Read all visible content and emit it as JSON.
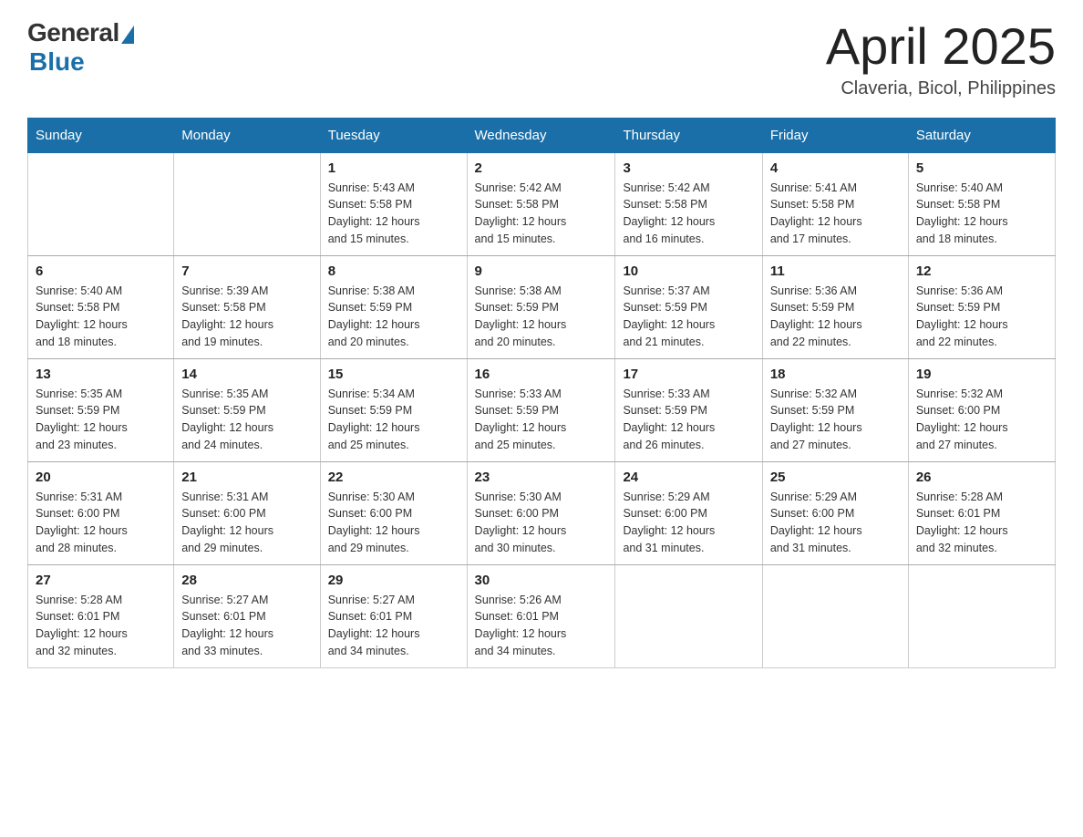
{
  "logo": {
    "general": "General",
    "blue": "Blue"
  },
  "title": {
    "month_year": "April 2025",
    "location": "Claveria, Bicol, Philippines"
  },
  "days_of_week": [
    "Sunday",
    "Monday",
    "Tuesday",
    "Wednesday",
    "Thursday",
    "Friday",
    "Saturday"
  ],
  "weeks": [
    [
      {
        "day": "",
        "info": ""
      },
      {
        "day": "",
        "info": ""
      },
      {
        "day": "1",
        "info": "Sunrise: 5:43 AM\nSunset: 5:58 PM\nDaylight: 12 hours\nand 15 minutes."
      },
      {
        "day": "2",
        "info": "Sunrise: 5:42 AM\nSunset: 5:58 PM\nDaylight: 12 hours\nand 15 minutes."
      },
      {
        "day": "3",
        "info": "Sunrise: 5:42 AM\nSunset: 5:58 PM\nDaylight: 12 hours\nand 16 minutes."
      },
      {
        "day": "4",
        "info": "Sunrise: 5:41 AM\nSunset: 5:58 PM\nDaylight: 12 hours\nand 17 minutes."
      },
      {
        "day": "5",
        "info": "Sunrise: 5:40 AM\nSunset: 5:58 PM\nDaylight: 12 hours\nand 18 minutes."
      }
    ],
    [
      {
        "day": "6",
        "info": "Sunrise: 5:40 AM\nSunset: 5:58 PM\nDaylight: 12 hours\nand 18 minutes."
      },
      {
        "day": "7",
        "info": "Sunrise: 5:39 AM\nSunset: 5:58 PM\nDaylight: 12 hours\nand 19 minutes."
      },
      {
        "day": "8",
        "info": "Sunrise: 5:38 AM\nSunset: 5:59 PM\nDaylight: 12 hours\nand 20 minutes."
      },
      {
        "day": "9",
        "info": "Sunrise: 5:38 AM\nSunset: 5:59 PM\nDaylight: 12 hours\nand 20 minutes."
      },
      {
        "day": "10",
        "info": "Sunrise: 5:37 AM\nSunset: 5:59 PM\nDaylight: 12 hours\nand 21 minutes."
      },
      {
        "day": "11",
        "info": "Sunrise: 5:36 AM\nSunset: 5:59 PM\nDaylight: 12 hours\nand 22 minutes."
      },
      {
        "day": "12",
        "info": "Sunrise: 5:36 AM\nSunset: 5:59 PM\nDaylight: 12 hours\nand 22 minutes."
      }
    ],
    [
      {
        "day": "13",
        "info": "Sunrise: 5:35 AM\nSunset: 5:59 PM\nDaylight: 12 hours\nand 23 minutes."
      },
      {
        "day": "14",
        "info": "Sunrise: 5:35 AM\nSunset: 5:59 PM\nDaylight: 12 hours\nand 24 minutes."
      },
      {
        "day": "15",
        "info": "Sunrise: 5:34 AM\nSunset: 5:59 PM\nDaylight: 12 hours\nand 25 minutes."
      },
      {
        "day": "16",
        "info": "Sunrise: 5:33 AM\nSunset: 5:59 PM\nDaylight: 12 hours\nand 25 minutes."
      },
      {
        "day": "17",
        "info": "Sunrise: 5:33 AM\nSunset: 5:59 PM\nDaylight: 12 hours\nand 26 minutes."
      },
      {
        "day": "18",
        "info": "Sunrise: 5:32 AM\nSunset: 5:59 PM\nDaylight: 12 hours\nand 27 minutes."
      },
      {
        "day": "19",
        "info": "Sunrise: 5:32 AM\nSunset: 6:00 PM\nDaylight: 12 hours\nand 27 minutes."
      }
    ],
    [
      {
        "day": "20",
        "info": "Sunrise: 5:31 AM\nSunset: 6:00 PM\nDaylight: 12 hours\nand 28 minutes."
      },
      {
        "day": "21",
        "info": "Sunrise: 5:31 AM\nSunset: 6:00 PM\nDaylight: 12 hours\nand 29 minutes."
      },
      {
        "day": "22",
        "info": "Sunrise: 5:30 AM\nSunset: 6:00 PM\nDaylight: 12 hours\nand 29 minutes."
      },
      {
        "day": "23",
        "info": "Sunrise: 5:30 AM\nSunset: 6:00 PM\nDaylight: 12 hours\nand 30 minutes."
      },
      {
        "day": "24",
        "info": "Sunrise: 5:29 AM\nSunset: 6:00 PM\nDaylight: 12 hours\nand 31 minutes."
      },
      {
        "day": "25",
        "info": "Sunrise: 5:29 AM\nSunset: 6:00 PM\nDaylight: 12 hours\nand 31 minutes."
      },
      {
        "day": "26",
        "info": "Sunrise: 5:28 AM\nSunset: 6:01 PM\nDaylight: 12 hours\nand 32 minutes."
      }
    ],
    [
      {
        "day": "27",
        "info": "Sunrise: 5:28 AM\nSunset: 6:01 PM\nDaylight: 12 hours\nand 32 minutes."
      },
      {
        "day": "28",
        "info": "Sunrise: 5:27 AM\nSunset: 6:01 PM\nDaylight: 12 hours\nand 33 minutes."
      },
      {
        "day": "29",
        "info": "Sunrise: 5:27 AM\nSunset: 6:01 PM\nDaylight: 12 hours\nand 34 minutes."
      },
      {
        "day": "30",
        "info": "Sunrise: 5:26 AM\nSunset: 6:01 PM\nDaylight: 12 hours\nand 34 minutes."
      },
      {
        "day": "",
        "info": ""
      },
      {
        "day": "",
        "info": ""
      },
      {
        "day": "",
        "info": ""
      }
    ]
  ]
}
